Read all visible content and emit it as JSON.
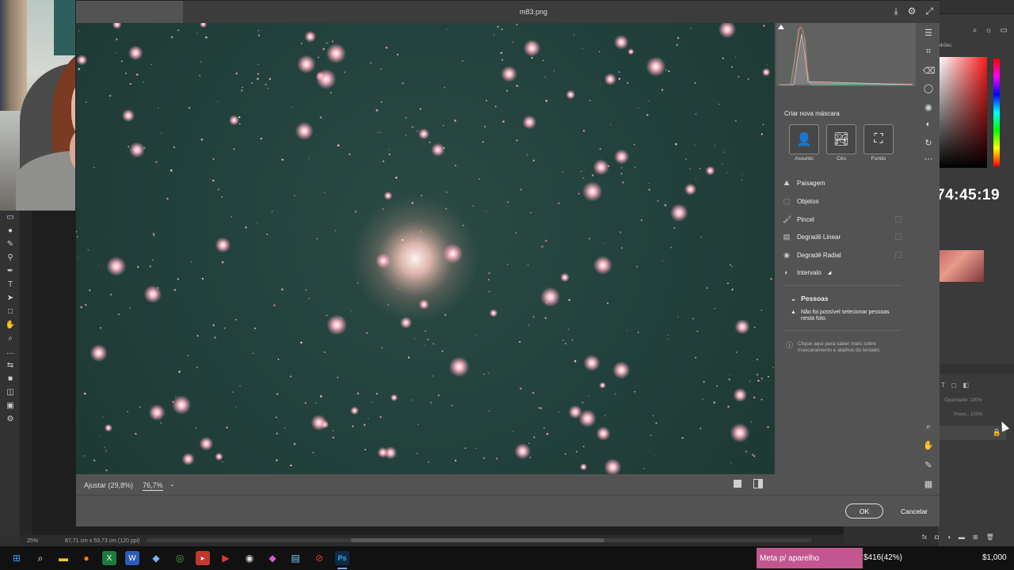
{
  "dialog": {
    "title": "m83.png",
    "fit_label": "Ajustar (29,8%)",
    "zoom_value": "76,7%",
    "ok_label": "OK",
    "cancel_label": "Cancelar"
  },
  "mask_panel": {
    "heading": "Criar nova máscara",
    "presets": [
      {
        "label": "Assunto",
        "icon": "person-icon"
      },
      {
        "label": "Céu",
        "icon": "sky-icon"
      },
      {
        "label": "Fundo",
        "icon": "background-icon"
      }
    ],
    "options": [
      {
        "label": "Paisagem",
        "icon": "landscape-icon"
      },
      {
        "label": "Objetos",
        "icon": "objects-icon"
      },
      {
        "label": "Pincel",
        "icon": "brush-icon"
      },
      {
        "label": "Degradê Linear",
        "icon": "linear-gradient-icon"
      },
      {
        "label": "Degradê Radial",
        "icon": "radial-gradient-icon"
      },
      {
        "label": "Intervalo",
        "icon": "range-icon"
      }
    ],
    "people_heading": "Pessoas",
    "people_message": "Não foi possível selecionar pessoas nesta foto.",
    "help_message": "Clique aqui para saber mais sobre mascaramento e atalhos do teclado."
  },
  "photoshop": {
    "status_zoom": "25%",
    "status_dims": "87,71 cm x 59,73 cm (120 ppi)",
    "panel_tab_label": "drões",
    "opacity_label": "Opacidade:",
    "opacity_value": "100%",
    "fill_label": "Preen.:",
    "fill_value": "100%"
  },
  "stream": {
    "timer": "74:45:19",
    "ticker_label": "Meta p/ aparelho",
    "ticker_value": "$416(42%)",
    "ticker_goal": "$1,000"
  },
  "colors": {
    "dialog_bg": "#535353",
    "preview_bg": "#22403b",
    "star_color": "#f2a4b5",
    "ticker_bg": "#c2578f"
  }
}
